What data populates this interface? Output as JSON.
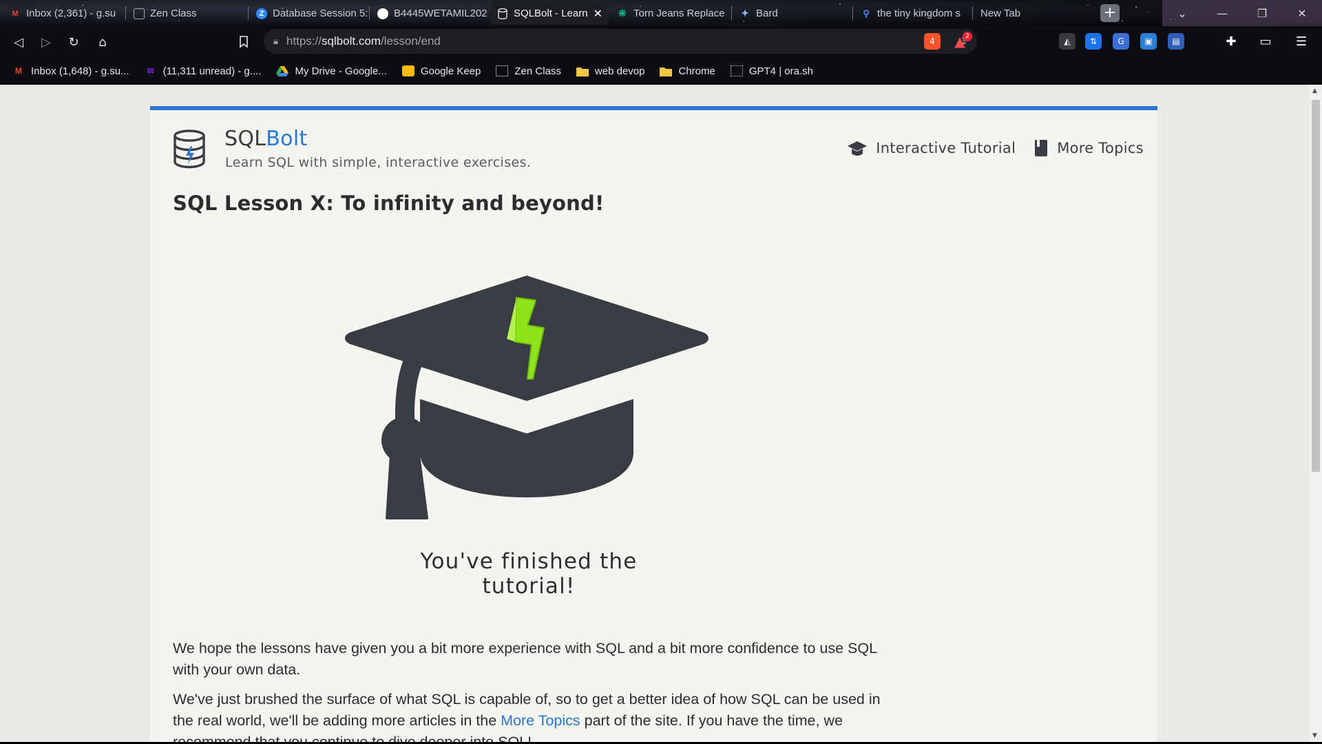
{
  "browser": {
    "tabs": [
      {
        "label": "Inbox (2,361) - g.su",
        "icon": "gmail-icon"
      },
      {
        "label": "Zen Class",
        "icon": "zen-class-icon"
      },
      {
        "label": "Database Session 5:",
        "icon": "zoom-icon"
      },
      {
        "label": "B4445WETAMIL202",
        "icon": "github-icon"
      },
      {
        "label": "SQLBolt - Learn",
        "icon": "sqlbolt-icon",
        "active": true
      },
      {
        "label": "Torn Jeans Replace",
        "icon": "chatgpt-icon"
      },
      {
        "label": "Bard",
        "icon": "bard-icon"
      },
      {
        "label": "the tiny kingdom s",
        "icon": "search-icon"
      },
      {
        "label": "New Tab",
        "icon": ""
      }
    ],
    "new_tab_label": "+",
    "url": {
      "prefix": "https://",
      "host": "sqlbolt.com",
      "path": "/lesson/end"
    },
    "ext_badges": {
      "brave": "4",
      "rewards": "2"
    },
    "bookmarks": [
      {
        "label": "Inbox (1,648) - g.su...",
        "icon": "gmail-icon"
      },
      {
        "label": "(11,311 unread) - g....",
        "icon": "yahoo-mail-icon"
      },
      {
        "label": "My Drive - Google...",
        "icon": "google-drive-icon"
      },
      {
        "label": "Google Keep",
        "icon": "google-keep-icon"
      },
      {
        "label": "Zen Class",
        "icon": "zen-class-icon"
      },
      {
        "label": "web devop",
        "icon": "folder-icon"
      },
      {
        "label": "Chrome",
        "icon": "folder-icon"
      },
      {
        "label": "GPT4 | ora.sh",
        "icon": "ora-icon"
      }
    ]
  },
  "site": {
    "brand_main": "SQL",
    "brand_accent": "Bolt",
    "tagline": "Learn SQL with simple, interactive exercises.",
    "nav": [
      {
        "label": "Interactive Tutorial",
        "icon": "graduation-cap-icon"
      },
      {
        "label": "More Topics",
        "icon": "book-icon"
      }
    ],
    "lesson_title": "SQL Lesson X: To infinity and beyond!",
    "finished_text": "You've finished the tutorial!",
    "para1": "We hope the lessons have given you a bit more experience with SQL and a bit more confidence to use SQL with your own data.",
    "para2_before": "We've just brushed the surface of what SQL is capable of, so to get a better idea of how SQL can be used in the real world, we'll be adding more articles in the ",
    "para2_link": "More Topics",
    "para2_after": " part of the site. If you have the time, we recommend that you continue to dive deeper into SQL!"
  },
  "colors": {
    "accent": "#2777d3",
    "bolt_green": "#8fe31a",
    "cap_dark": "#3a3c44"
  }
}
